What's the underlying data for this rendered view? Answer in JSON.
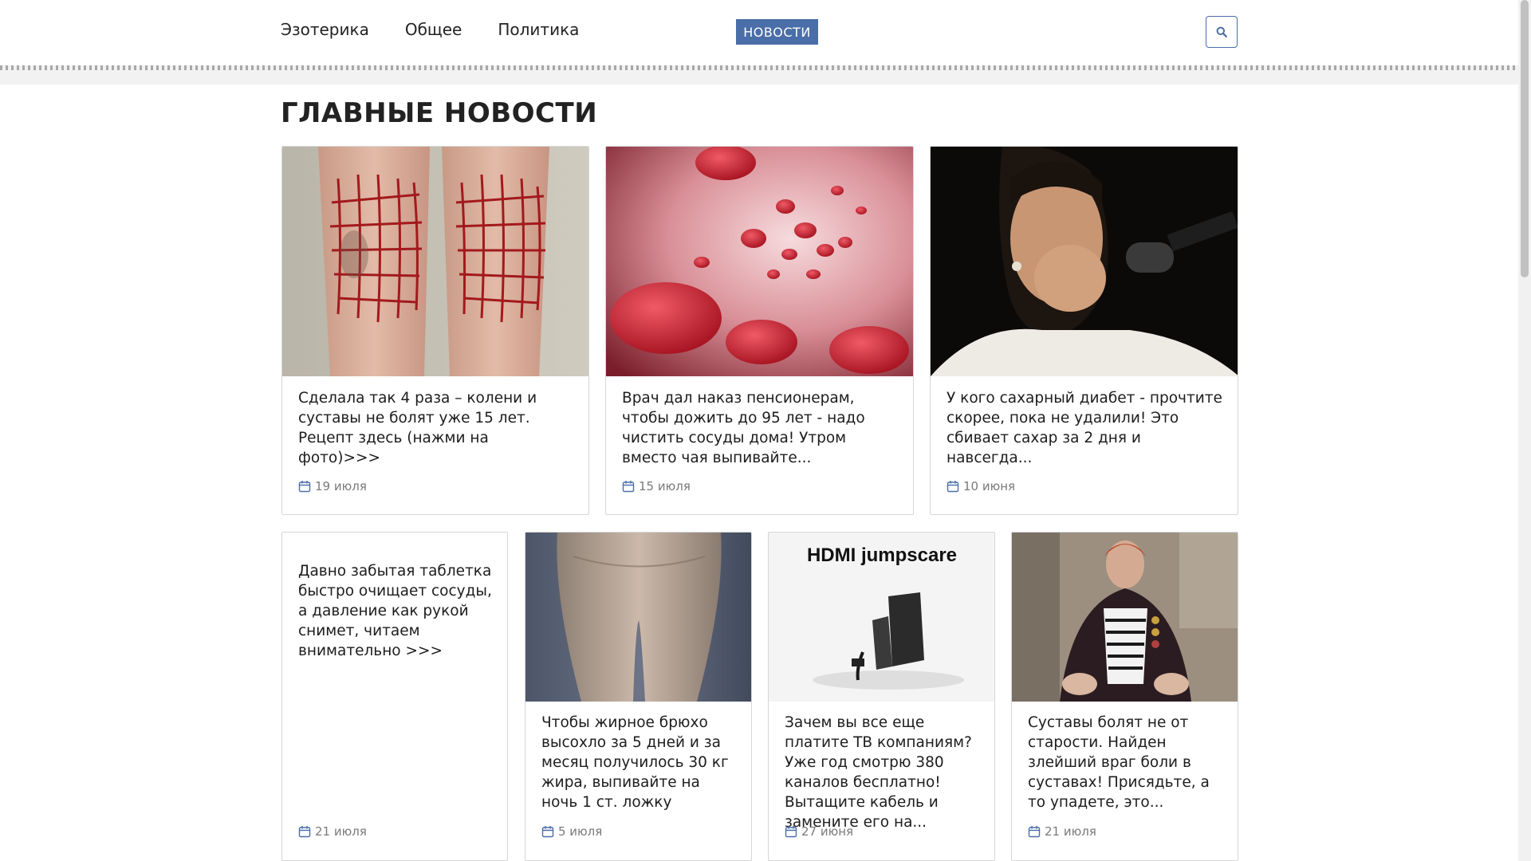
{
  "nav": {
    "items": [
      {
        "label": "Эзотерика"
      },
      {
        "label": "Общее"
      },
      {
        "label": "Политика"
      }
    ],
    "news_button": "НОВОСТИ",
    "search_icon": "search-icon",
    "accent_color": "#4a6ea8"
  },
  "section_title": "ГЛАВНЫЕ НОВОСТИ",
  "cards": [
    {
      "title": "Сделала так 4 раза – колени и суставы не болят уже 15 лет. Рецепт здесь (нажми на фото)>>>",
      "date": "19 июля"
    },
    {
      "title": "Врач дал наказ пенсионерам, чтобы дожить до 95 лет - надо чистить сосуды дома! Утром вместо чая выпивайте...",
      "date": "15 июля"
    },
    {
      "title": "У кого сахарный диабет - прочтите скорее, пока не удалили! Это сбивает сахар за 2 дня и навсегда...",
      "date": "10 июня"
    },
    {
      "title": "Давно забытая таблетка быстро очищает сосуды, а давление как рукой снимет, читаем внимательно >>>",
      "date": "21 июля"
    },
    {
      "title": "Чтобы жирное брюхо высохло за 5 дней и за месяц получилось 30 кг жира, выпивайте на ночь 1 ст. ложку",
      "date": "5 июля"
    },
    {
      "title": "Зачем вы все еще платите ТВ компаниям? Уже год смотрю 380 каналов бесплатно! Вытащите кабель и замените его на...",
      "date": "27 июня"
    },
    {
      "title": "Суставы болят не от старости. Найден злейший враг боли в суставах! Присядьте, а то упадете, это...",
      "date": "21 июля"
    }
  ],
  "image_text": {
    "hdmi": "HDMI jumpscare"
  }
}
